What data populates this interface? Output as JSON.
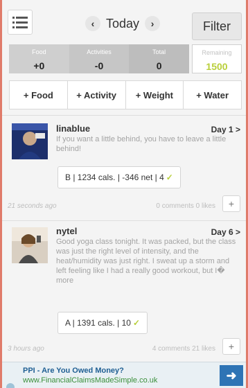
{
  "header": {
    "date_label": "Today",
    "filter_label": "Filter",
    "prev_icon": "chevron-left-icon",
    "next_icon": "chevron-right-icon",
    "menu_icon": "list-menu-icon"
  },
  "summary": {
    "food_label": "Food",
    "food_value": "+0",
    "activities_label": "Activities",
    "activities_value": "-0",
    "total_label": "Total",
    "total_value": "0",
    "remaining_label": "Remaining",
    "remaining_value": "1500"
  },
  "actions": [
    {
      "label": "+ Food"
    },
    {
      "label": "+ Activity"
    },
    {
      "label": "+ Weight"
    },
    {
      "label": "+ Water"
    }
  ],
  "feed": [
    {
      "username": "linablue",
      "day": "Day 1 >",
      "text": "If you want a little behind, you have to leave a little behind!",
      "stats": "B | 1234 cals. | -346 net | 4",
      "time": "21 seconds ago",
      "social": "0 comments 0 likes"
    },
    {
      "username": "nytel",
      "day": "Day 6 >",
      "text": "Good yoga class tonight. It was packed, but the class was just the right level of intensity, and the heat/humidity was just right. I sweat up a storm and left feeling like I had a really good workout, but I� more",
      "stats": "A | 1391 cals. | 10",
      "time": "3 hours ago",
      "social": "4 comments 21 likes"
    }
  ],
  "ad": {
    "title": "PPI - Are You Owed Money?",
    "url": "www.FinancialClaimsMadeSimple.co.uk"
  },
  "colors": {
    "accent_green": "#b8cf3a",
    "frame": "#e07b6a",
    "ad_blue": "#2e74b5"
  }
}
